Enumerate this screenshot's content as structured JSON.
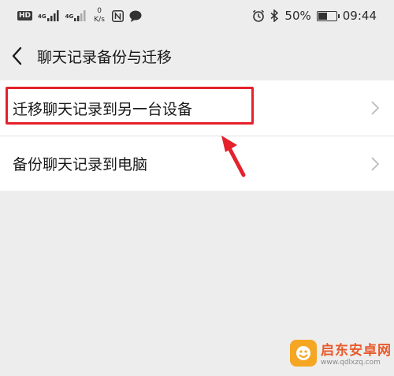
{
  "status_bar": {
    "hd_badge": "HD",
    "network_1": "4G",
    "network_2": "4G",
    "speed_value": "0",
    "speed_unit": "K/s",
    "battery": "50%",
    "battery_level": 0.5,
    "time": "09:44"
  },
  "nav": {
    "title": "聊天记录备份与迁移"
  },
  "list": {
    "items": [
      {
        "label": "迁移聊天记录到另一台设备"
      },
      {
        "label": "备份聊天记录到电脑"
      }
    ]
  },
  "colors": {
    "highlight": "#e5212b",
    "background": "#ededed"
  },
  "watermark": {
    "name": "启东安卓网",
    "url": "www.qdlxzq.com"
  }
}
